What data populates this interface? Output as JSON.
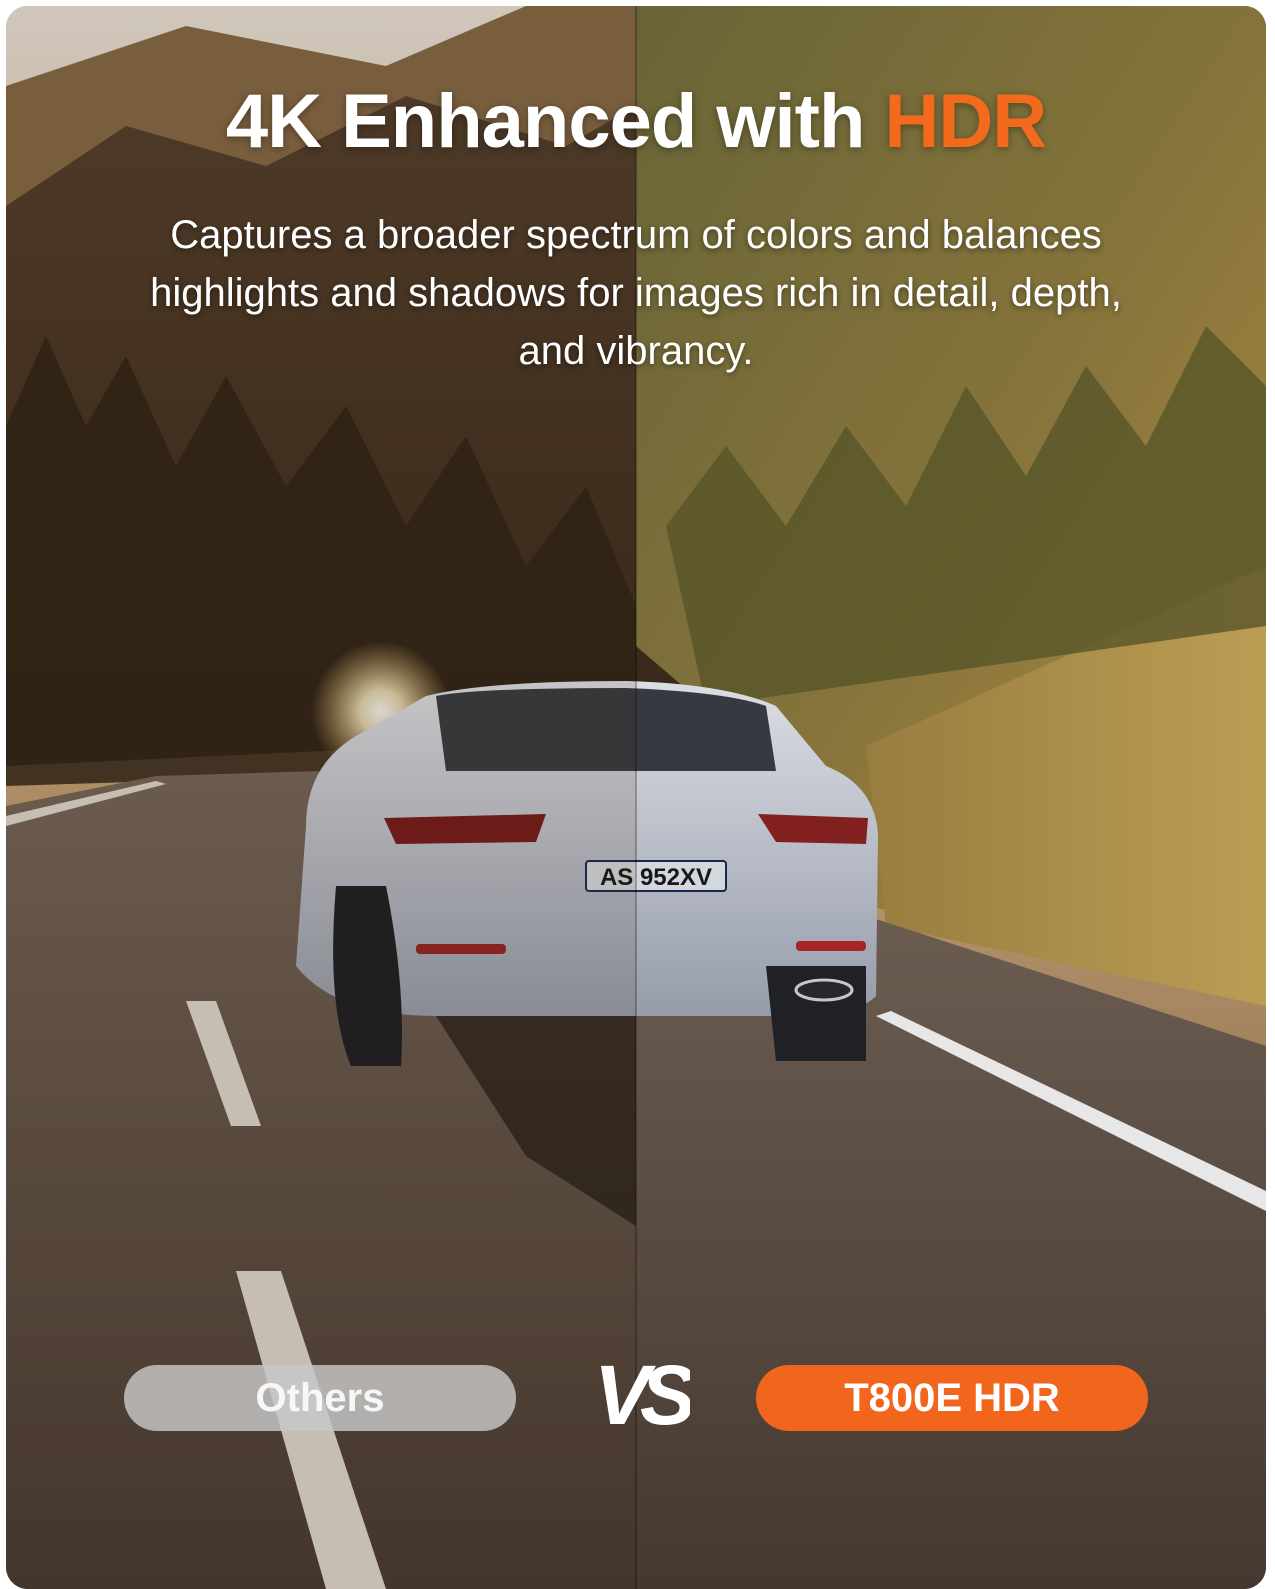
{
  "header": {
    "title_main": "4K Enhanced with",
    "title_accent": "HDR",
    "subtitle": "Captures a broader spectrum of colors and balances highlights and shadows for images rich in detail, depth, and vibrancy."
  },
  "comparison": {
    "left_label": "Others",
    "vs_label": "VS",
    "right_label": "T800E HDR"
  },
  "car": {
    "plate_text": "AS 952XV"
  },
  "colors": {
    "accent": "#f36a1c",
    "left_pill": "#c8c8c8",
    "right_pill": "#f2651c"
  }
}
